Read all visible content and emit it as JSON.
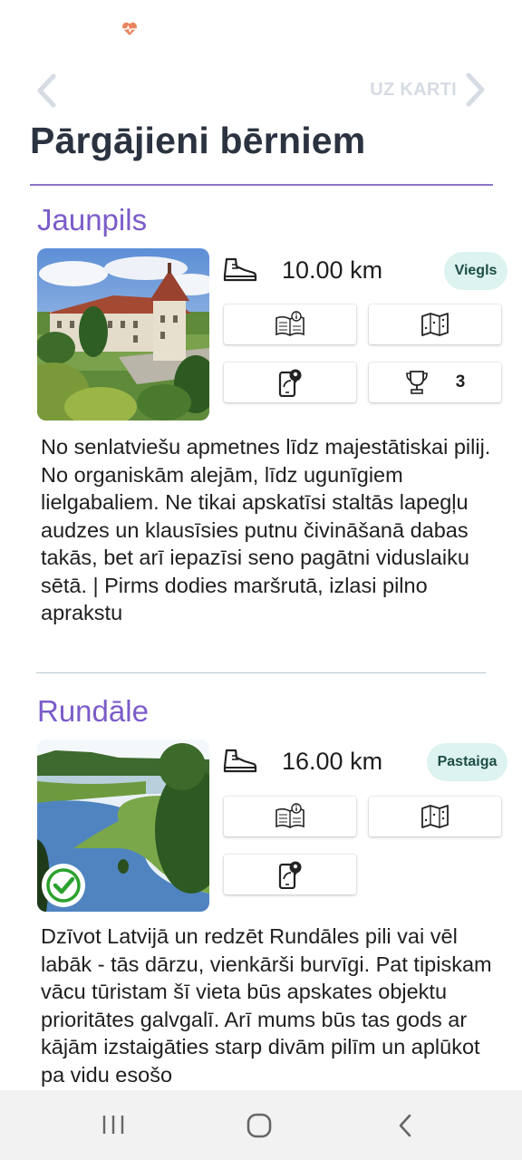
{
  "colors": {
    "title": "#2b3240",
    "accent": "#7b5cc9",
    "badge_bg": "#dcf3ef",
    "nav_disabled": "#d6dbe4",
    "heart": "#e8845d"
  },
  "status_bar": {
    "icon": "heart-pulse-icon"
  },
  "nav": {
    "back_icon": "chevron-left-icon",
    "map_label": "UZ KARTI",
    "map_icon": "chevron-right-icon"
  },
  "page_title": "Pārgājieni bērniem",
  "routes": [
    {
      "name": "Jaunpils",
      "distance": "10.00 km",
      "level": "Viegls",
      "actions": [
        "book-info-icon",
        "map-icon",
        "phone-location-icon",
        "trophy-icon"
      ],
      "trophy_count": "3",
      "completed": false,
      "description": "No senlatviešu apmetnes līdz majestātiskai pilij. No organiskām alejām, līdz ugunīgiem lielgabaliem. Ne tikai apskatīsi staltās lapegļu audzes un klausīsies putnu čivināšanā dabas takās, bet arī iepazīsi seno pagātni viduslaiku sētā. | Pirms dodies maršrutā, izlasi pilno aprakstu"
    },
    {
      "name": "Rundāle",
      "distance": "16.00 km",
      "level": "Pastaiga",
      "actions": [
        "book-info-icon",
        "map-icon",
        "phone-location-icon"
      ],
      "completed": true,
      "description": "Dzīvot Latvijā un redzēt Rundāles pili vai vēl labāk - tās dārzu, vienkārši burvīgi. Pat tipiskam vācu tūristam šī vieta būs apskates objektu prioritātes galvgalī. Arī mums būs tas gods ar kājām izstaigāties starp divām pilīm un aplūkot pa vidu esošo"
    }
  ],
  "system_nav": [
    "recent-apps-icon",
    "home-icon",
    "back-icon"
  ]
}
